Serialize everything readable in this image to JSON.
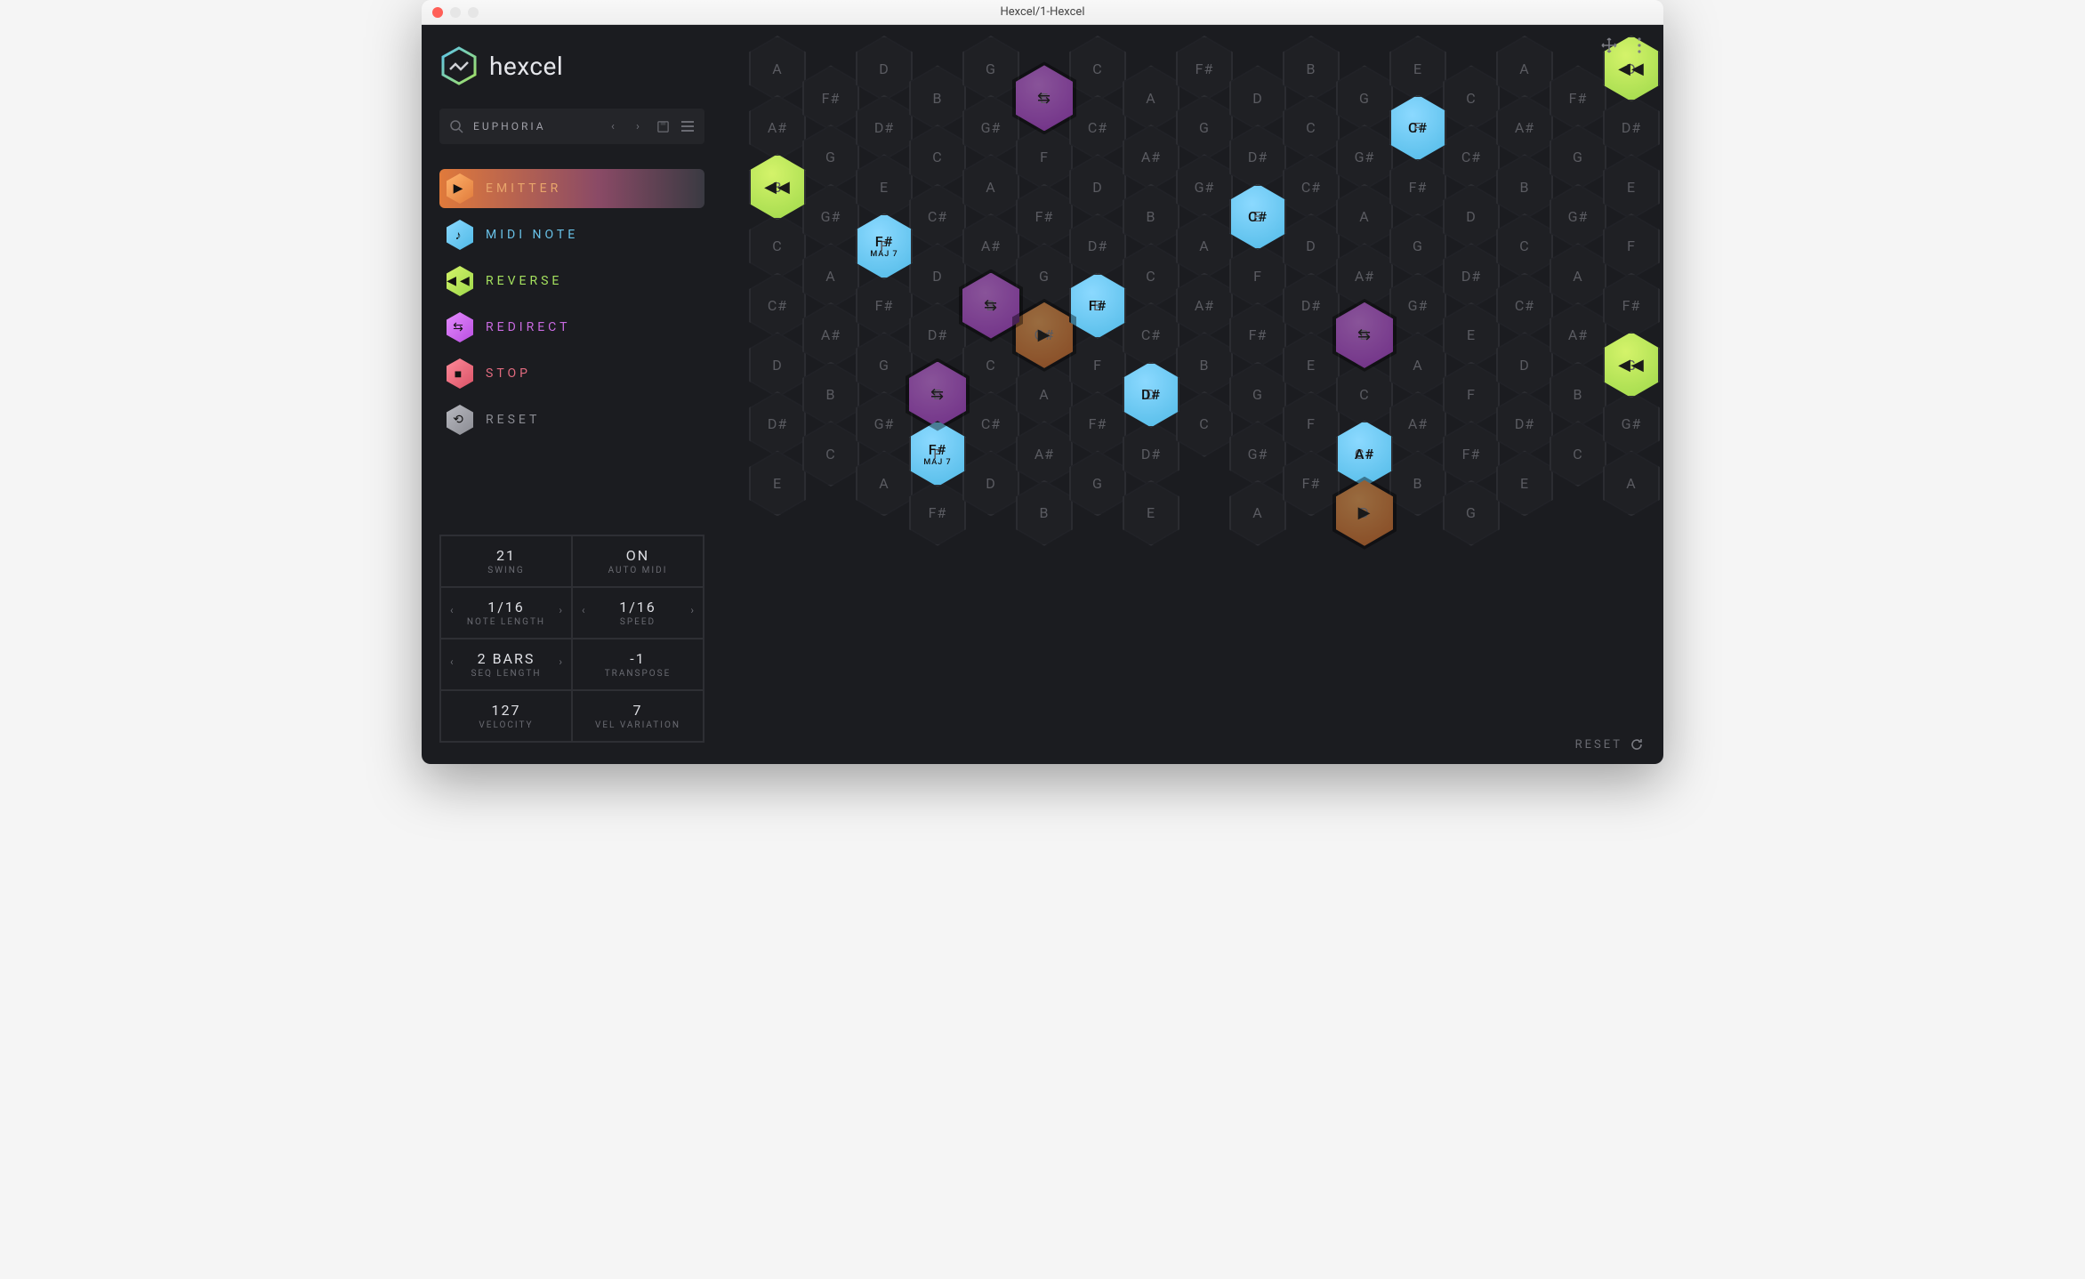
{
  "window": {
    "title": "Hexcel/1-Hexcel"
  },
  "brand": {
    "name": "hexcel"
  },
  "preset": {
    "name": "EUPHORIA",
    "prev_icon": "chevron-left-icon",
    "next_icon": "chevron-right-icon",
    "save_icon": "save-icon",
    "menu_icon": "hamburger-icon",
    "search_icon": "search-icon"
  },
  "tools": [
    {
      "id": "emitter",
      "label": "EMITTER",
      "glyph": "▶",
      "selected": true
    },
    {
      "id": "midi",
      "label": "MIDI NOTE",
      "glyph": "♪",
      "selected": false
    },
    {
      "id": "reverse",
      "label": "REVERSE",
      "glyph": "◀◀",
      "selected": false
    },
    {
      "id": "redirect",
      "label": "REDIRECT",
      "glyph": "⇆",
      "selected": false
    },
    {
      "id": "stop",
      "label": "STOP",
      "glyph": "■",
      "selected": false
    },
    {
      "id": "reset",
      "label": "RESET",
      "glyph": "⟲",
      "selected": false
    }
  ],
  "params": {
    "swing": {
      "value": "21",
      "label": "SWING",
      "arrows": false
    },
    "automidi": {
      "value": "ON",
      "label": "AUTO MIDI",
      "arrows": false
    },
    "notelength": {
      "value": "1/16",
      "label": "NOTE LENGTH",
      "arrows": true
    },
    "speed": {
      "value": "1/16",
      "label": "SPEED",
      "arrows": true
    },
    "seqlength": {
      "value": "2 BARS",
      "label": "SEQ LENGTH",
      "arrows": true
    },
    "transpose": {
      "value": "-1",
      "label": "TRANSPOSE",
      "arrows": false
    },
    "velocity": {
      "value": "127",
      "label": "VELOCITY",
      "arrows": false
    },
    "velvariation": {
      "value": "7",
      "label": "VEL VARIATION",
      "arrows": false
    }
  },
  "footer": {
    "reset_label": "RESET"
  },
  "grid": {
    "cols": 17,
    "rows_even": [
      "A",
      "A#",
      "B",
      "C",
      "C#",
      "D",
      "D#",
      "E"
    ],
    "rows_odd": [
      "F#",
      "G",
      "G#",
      "A",
      "A#",
      "B",
      "C"
    ],
    "row_positions_even": [
      0,
      1,
      2,
      3,
      4,
      5,
      6,
      7
    ],
    "row_positions_odd": [
      0,
      1,
      2,
      3,
      4,
      5,
      6
    ],
    "full_rows": [
      [
        "A",
        "A#",
        "B",
        "C",
        "C#",
        "D",
        "D#",
        "E"
      ],
      [
        "F#",
        "G",
        "G#",
        "A",
        "A#",
        "B",
        "C"
      ],
      [
        "D",
        "D#",
        "E",
        "F",
        "F#",
        "G",
        "G#",
        "A"
      ],
      [
        "B",
        "C",
        "C#",
        "D",
        "D#",
        "E",
        "F",
        "F#"
      ],
      [
        "G",
        "G#",
        "A",
        "A#",
        "B",
        "C",
        "C#",
        "D"
      ],
      [
        "E",
        "F",
        "F#",
        "G",
        "G#",
        "A",
        "A#",
        "B"
      ],
      [
        "C",
        "C#",
        "D",
        "D#",
        "E",
        "F",
        "F#",
        "G"
      ],
      [
        "A",
        "A#",
        "B",
        "C",
        "C#",
        "D",
        "D#",
        "E"
      ],
      [
        "F#",
        "G",
        "G#",
        "A",
        "A#",
        "B",
        "C"
      ],
      [
        "D",
        "D#",
        "E",
        "F",
        "F#",
        "G",
        "G#",
        "A"
      ],
      [
        "B",
        "C",
        "C#",
        "D",
        "D#",
        "E",
        "F",
        "F#"
      ],
      [
        "G",
        "G#",
        "A",
        "A#",
        "B",
        "C",
        "C#",
        "D"
      ],
      [
        "E",
        "F",
        "F#",
        "G",
        "G#",
        "A",
        "A#",
        "B"
      ],
      [
        "C",
        "C#",
        "D",
        "D#",
        "E",
        "F",
        "F#",
        "G"
      ],
      [
        "A",
        "A#",
        "B",
        "C",
        "C#",
        "D",
        "D#",
        "E"
      ],
      [
        "F#",
        "G",
        "G#",
        "A",
        "A#",
        "B",
        "C"
      ],
      [
        "D",
        "D#",
        "E",
        "F",
        "F#",
        "G",
        "G#",
        "A"
      ]
    ]
  },
  "tokens": [
    {
      "type": "redirect",
      "col": 5,
      "row": 0,
      "glyph": "⇆"
    },
    {
      "type": "reverse",
      "col": 16,
      "row": 0,
      "glyph": "◀◀"
    },
    {
      "type": "midi",
      "col": 12,
      "row": 1,
      "note": "C#"
    },
    {
      "type": "reverse",
      "col": 0,
      "row": 2,
      "glyph": "◀◀"
    },
    {
      "type": "midi",
      "col": 9,
      "row": 2,
      "note": "C#"
    },
    {
      "type": "midi",
      "col": 2,
      "row": 3,
      "note": "F#",
      "sub": "MAJ 7"
    },
    {
      "type": "emitter",
      "col": 5,
      "row": 4,
      "glyph": "▶"
    },
    {
      "type": "redirect",
      "col": 4,
      "row": 4,
      "glyph": "⇆"
    },
    {
      "type": "redirect",
      "col": 3,
      "row": 5,
      "glyph": "⇆"
    },
    {
      "type": "midi",
      "col": 6,
      "row": 4,
      "note": "F#"
    },
    {
      "type": "midi",
      "col": 7,
      "row": 5,
      "note": "D#"
    },
    {
      "type": "redirect",
      "col": 11,
      "row": 4,
      "glyph": "⇆"
    },
    {
      "type": "reverse",
      "col": 16,
      "row": 5,
      "glyph": "◀◀"
    },
    {
      "type": "midi",
      "col": 3,
      "row": 6,
      "note": "F#",
      "sub": "MAJ 7"
    },
    {
      "type": "midi",
      "col": 11,
      "row": 6,
      "note": "A#"
    },
    {
      "type": "emitter",
      "col": 11,
      "row": 7,
      "glyph": "▶"
    }
  ],
  "colors": {
    "emitter": "#e88a3f",
    "midi": "#5dc4ea",
    "reverse": "#a8df55",
    "redirect": "#c361e0",
    "stop": "#e06479",
    "reset": "#8e8f96",
    "bg": "#1b1c20"
  }
}
